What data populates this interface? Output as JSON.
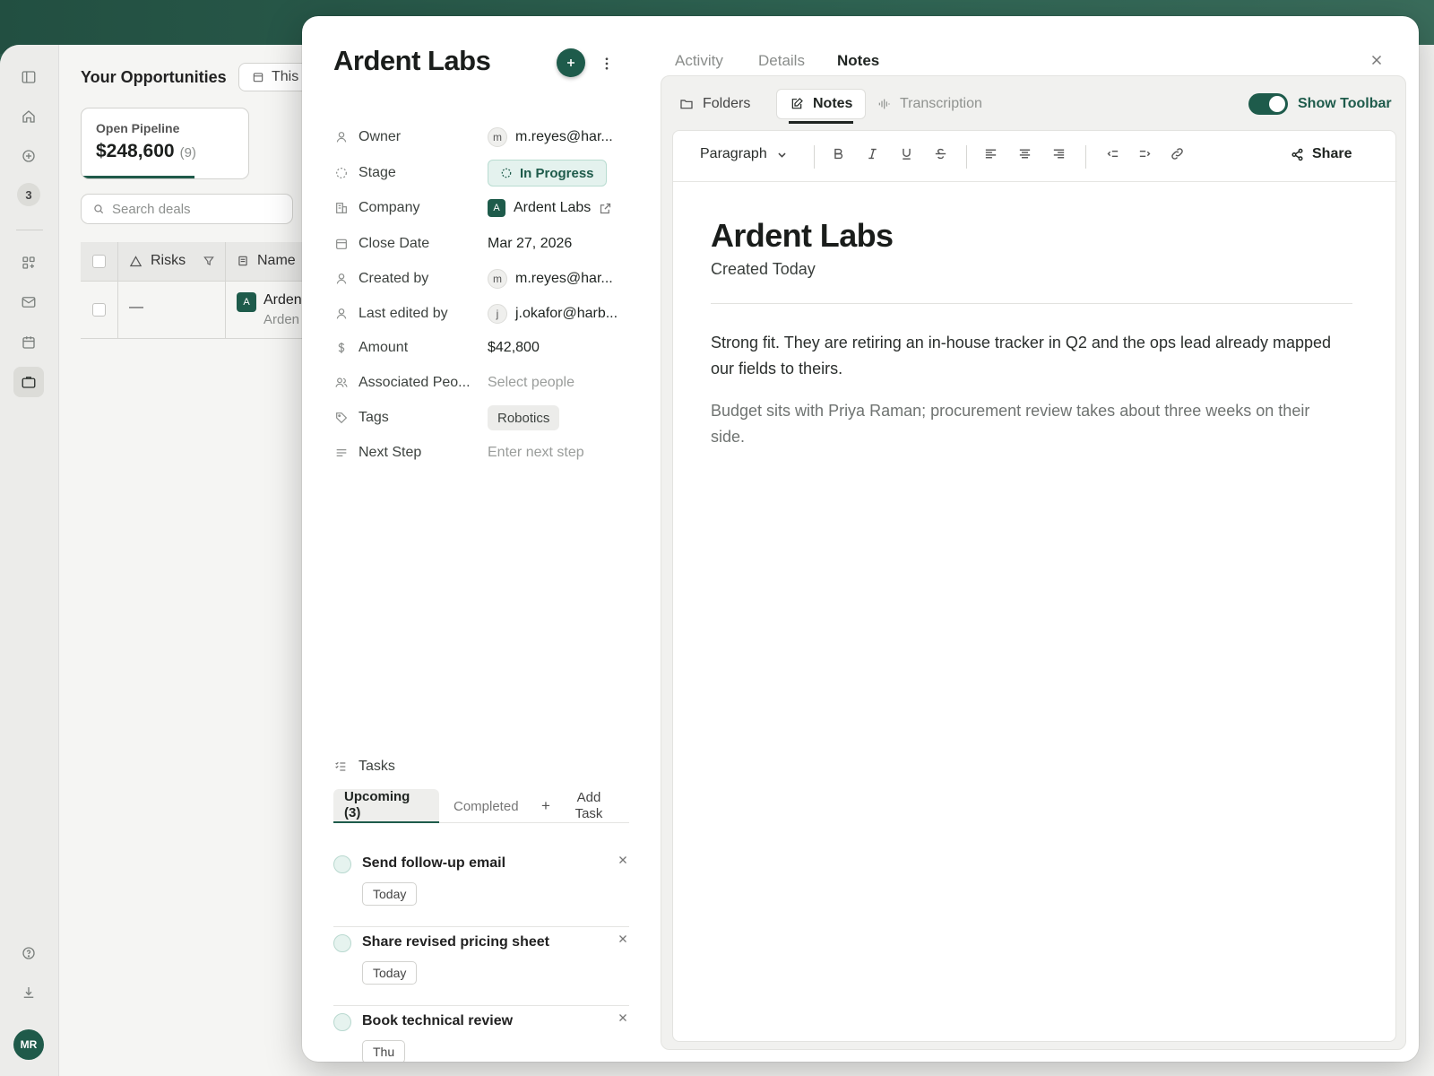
{
  "sidebar": {
    "badge_count": "3",
    "user_initials": "MR"
  },
  "list": {
    "title": "Your Opportunities",
    "period_filter": "This",
    "pipeline_label": "Open Pipeline",
    "pipeline_value": "$248,600",
    "pipeline_count": "(9)",
    "pipeline_progress": 0.68,
    "search_placeholder": "Search deals",
    "columns": {
      "risks": "Risks",
      "name": "Name"
    },
    "row": {
      "risk": "—",
      "name": "Arden",
      "sub": "Arden"
    }
  },
  "record": {
    "title": "Ardent Labs",
    "fields": [
      {
        "label": "Owner",
        "value": "m.reyes@har...",
        "avatar": "m"
      },
      {
        "label": "Stage",
        "value": "In Progress"
      },
      {
        "label": "Company",
        "value": "Ardent Labs",
        "logo": "A"
      },
      {
        "label": "Close Date",
        "value": "Mar 27, 2026"
      },
      {
        "label": "Created by",
        "value": "m.reyes@har...",
        "avatar": "m"
      },
      {
        "label": "Last edited by",
        "value": "j.okafor@harb...",
        "avatar": "j"
      },
      {
        "label": "Amount",
        "value": "$42,800"
      },
      {
        "label": "Associated Peo...",
        "value": "Select people"
      },
      {
        "label": "Tags",
        "value": "Robotics"
      },
      {
        "label": "Next Step",
        "value": "Enter next step"
      }
    ],
    "tasks": {
      "heading": "Tasks",
      "tab_upcoming_1": "Upcoming",
      "tab_upcoming_2": "(3)",
      "tab_completed": "Completed",
      "add_plus": "+",
      "add_task_1": "Add",
      "add_task_2": "Task",
      "items": [
        {
          "title": "Send follow-up email",
          "due": "Today"
        },
        {
          "title": "Share revised pricing sheet",
          "due": "Today"
        },
        {
          "title": "Book technical review",
          "due": "Thu"
        }
      ]
    }
  },
  "tabs": {
    "activity": "Activity",
    "details": "Details",
    "notes": "Notes"
  },
  "notes_panel": {
    "subtabs": {
      "folders": "Folders",
      "notes": "Notes",
      "transcription": "Transcription"
    },
    "toggle_label": "Show Toolbar",
    "toggle_on": true,
    "toolbar": {
      "block_style": "Paragraph",
      "share": "Share"
    },
    "doc": {
      "title": "Ardent Labs",
      "subtitle": "Created Today",
      "p1": "Strong fit. They are retiring an in-house tracker in Q2 and the ops lead already mapped our fields to theirs.",
      "p2": "Budget sits with Priya Raman; procurement review takes about three weeks on their side."
    }
  }
}
